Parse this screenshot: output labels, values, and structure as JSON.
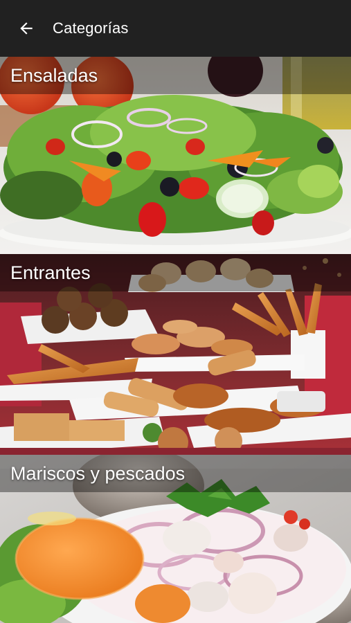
{
  "toolbar": {
    "back_icon": "arrow-left-icon",
    "title": "Categorías"
  },
  "categories": [
    {
      "label": "Ensaladas",
      "image": "salad-photo"
    },
    {
      "label": "Entrantes",
      "image": "appetizers-photo"
    },
    {
      "label": "Mariscos y pescados",
      "image": "seafood-photo"
    }
  ],
  "colors": {
    "toolbar_bg": "#212121",
    "toolbar_text": "#ffffff",
    "label_overlay": "rgba(0,0,0,0.38)"
  }
}
